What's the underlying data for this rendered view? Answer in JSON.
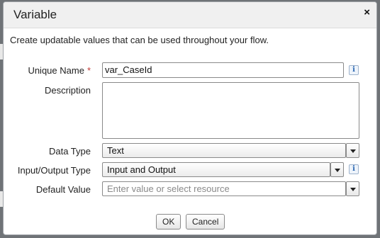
{
  "dialog": {
    "title": "Variable",
    "close_label": "×",
    "intro": "Create updatable values that can be used throughout your flow."
  },
  "form": {
    "unique_name": {
      "label": "Unique Name",
      "required_marker": "*",
      "value": "var_CaseId"
    },
    "description": {
      "label": "Description",
      "value": ""
    },
    "data_type": {
      "label": "Data Type",
      "value": "Text"
    },
    "io_type": {
      "label": "Input/Output Type",
      "value": "Input and Output"
    },
    "default_value": {
      "label": "Default Value",
      "placeholder": "Enter value or select resource"
    }
  },
  "icons": {
    "info": "i"
  },
  "buttons": {
    "ok": "OK",
    "cancel": "Cancel"
  }
}
